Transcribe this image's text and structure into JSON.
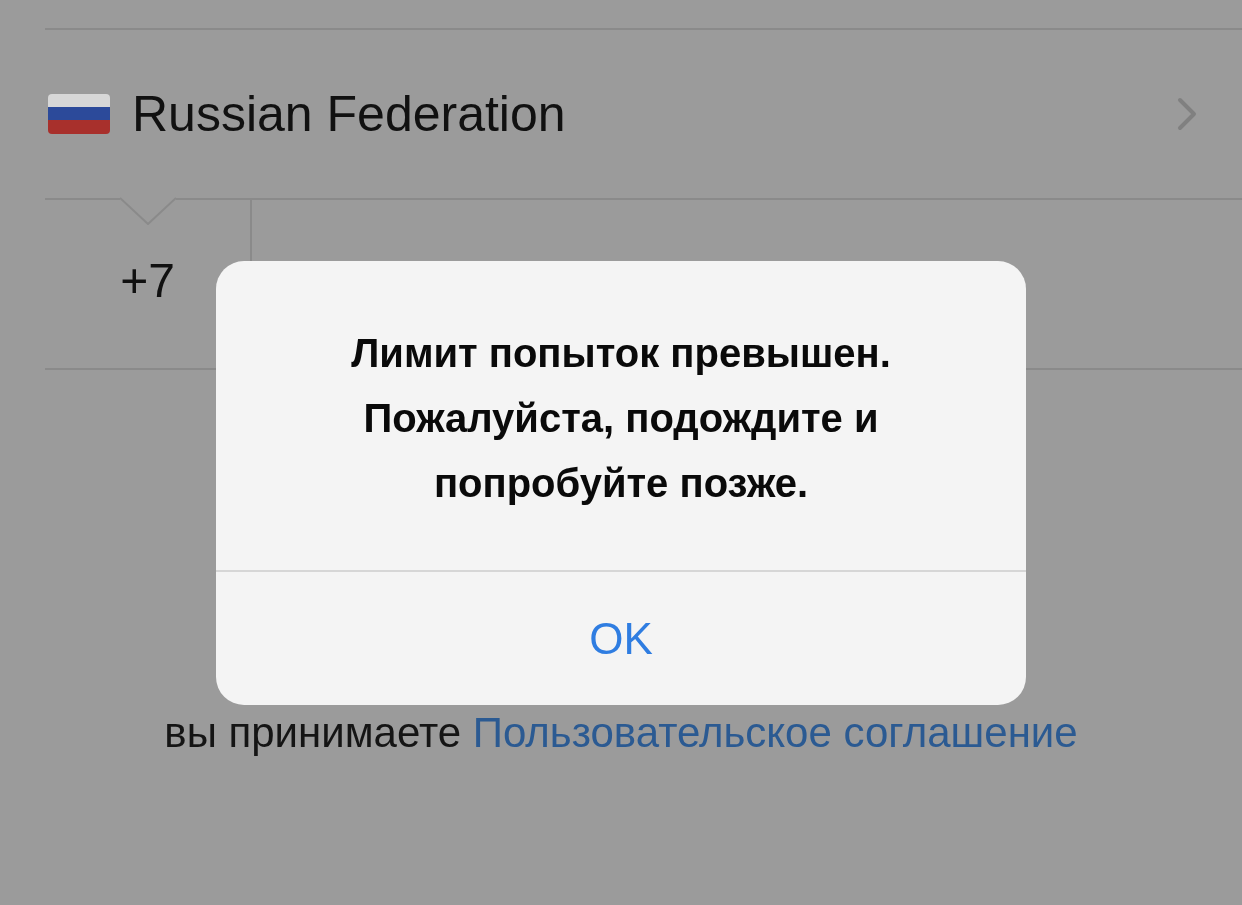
{
  "country": {
    "name": "Russian Federation"
  },
  "phone": {
    "code": "+7"
  },
  "terms": {
    "text": "вы принимаете",
    "link": "Пользовательское соглашение"
  },
  "alert": {
    "message": "Лимит попыток превышен. Пожалуйста, подождите и попробуйте позже.",
    "button": "OK"
  }
}
